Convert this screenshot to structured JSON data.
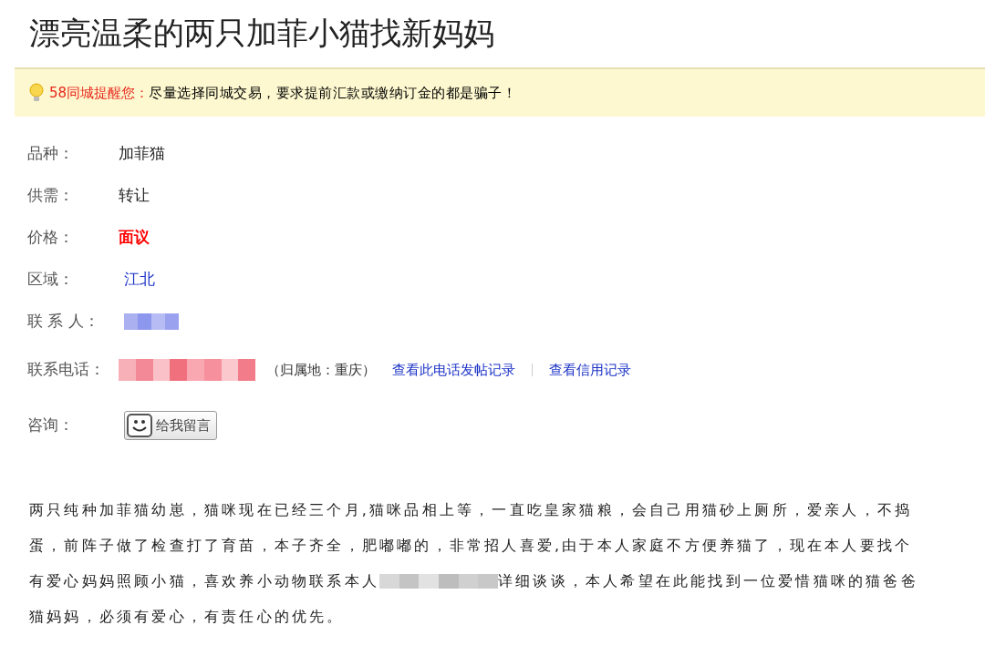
{
  "title": "漂亮温柔的两只加菲小猫找新妈妈",
  "notice": {
    "label": "58同城提醒您：",
    "text": "尽量选择同城交易，要求提前汇款或缴纳订金的都是骗子！"
  },
  "fields": [
    {
      "kind": "plain",
      "label": "品种：",
      "value": "加菲猫"
    },
    {
      "kind": "plain",
      "label": "供需：",
      "value": "转让"
    },
    {
      "kind": "price",
      "label": "价格：",
      "value": "面议"
    },
    {
      "kind": "link",
      "label": "区域：",
      "value": "江北"
    },
    {
      "kind": "redacted_name",
      "label": "联 系 人："
    },
    {
      "kind": "phone",
      "label": "联系电话：",
      "note": "（归属地：重庆）",
      "links": [
        "查看此电话发帖记录",
        "查看信用记录"
      ]
    },
    {
      "kind": "message",
      "label": "咨询：",
      "button": "给我留言"
    }
  ],
  "description": {
    "lines": [
      {
        "parts": [
          "两只纯种加菲猫幼崽，猫咪现在已经三个月,猫咪品相上等，一直吃皇家猫粮，会自己用猫砂上厕所，爱亲人，不捣"
        ]
      },
      {
        "parts": [
          "蛋，前阵子做了检查打了育苗，本子齐全，肥嘟嘟的，非常招人喜爱,由于本人家庭不方便养猫了，现在本人要找个"
        ]
      },
      {
        "parts": [
          "有爱心妈妈照顾小猫，喜欢养小动物联系本人",
          "详细谈谈，本人希望在此能找到一位爱惜猫咪的猫爸爸"
        ]
      },
      {
        "parts": [
          "猫妈妈，必须有爱心，有责任心的优先。"
        ]
      }
    ]
  }
}
